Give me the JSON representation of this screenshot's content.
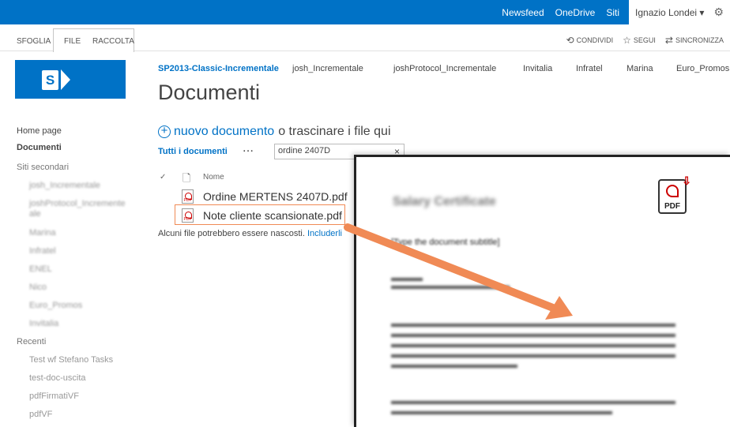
{
  "suitebar": {
    "links": [
      "Newsfeed",
      "OneDrive",
      "Siti"
    ],
    "user": "Ignazio Londei ▾",
    "gear": "gear-icon"
  },
  "ribbon": {
    "tabs": [
      "SFOGLIA",
      "FILE",
      "RACCOLTA"
    ],
    "actions": [
      {
        "icon": "share-icon",
        "label": "CONDIVIDI"
      },
      {
        "icon": "star-icon",
        "label": "SEGUI"
      },
      {
        "icon": "sync-icon",
        "label": "SINCRONIZZA"
      }
    ]
  },
  "topnav": [
    "SP2013-Classic-Incrementale",
    "josh_Incrementale",
    "joshProtocol_Incrementale",
    "Invitalia",
    "Infratel",
    "Marina",
    "Euro_Promos"
  ],
  "page_title": "Documenti",
  "leftnav": {
    "home": "Home page",
    "documents": "Documenti",
    "subsites_header": "Siti secondari",
    "subsites": [
      "josh_Incrementale",
      "joshProtocol_Incremente ale",
      "Marina",
      "Infratel",
      "ENEL",
      "Nico",
      "Euro_Promos",
      "Invitalia"
    ],
    "recent_header": "Recenti",
    "recent": [
      "Test wf Stefano Tasks",
      "test-doc-uscita",
      "pdfFirmatiVF",
      "pdfVF"
    ]
  },
  "main": {
    "new_link": "nuovo documento",
    "new_rest": "o trascinare i file qui",
    "view_name": "Tutti i documenti",
    "view_more": "···",
    "search_value": "ordine 2407D",
    "search_clear": "×",
    "col_name": "Nome",
    "files": [
      "Ordine MERTENS 2407D.pdf",
      "Note cliente scansionate.pdf"
    ],
    "hidden_note": "Alcuni file potrebbero essere nascosti.",
    "hidden_link": "Includerli",
    "pdf_badge": "PDF"
  },
  "preview": {
    "title": "Salary Certificate",
    "subtitle": "[Type the document subtitle]",
    "pdf_label": "PDF"
  },
  "colors": {
    "brand": "#0072c6",
    "highlight": "#f08a55"
  }
}
